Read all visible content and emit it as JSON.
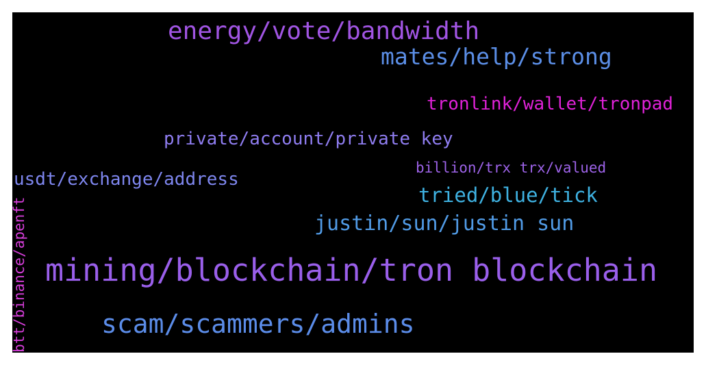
{
  "wordcloud": {
    "background": "#000000",
    "words": [
      {
        "text": "energy/vote/bandwidth",
        "color": "#a155e3"
      },
      {
        "text": "mates/help/strong",
        "color": "#5b8ee6"
      },
      {
        "text": "tronlink/wallet/tronpad",
        "color": "#e022d8"
      },
      {
        "text": "private/account/private key",
        "color": "#8f7df0"
      },
      {
        "text": "billion/trx trx/valued",
        "color": "#9d63e8"
      },
      {
        "text": "usdt/exchange/address",
        "color": "#7e86ee"
      },
      {
        "text": "tried/blue/tick",
        "color": "#3fb2e2"
      },
      {
        "text": "justin/sun/justin sun",
        "color": "#519be6"
      },
      {
        "text": "mining/blockchain/tron blockchain",
        "color": "#9a5fea"
      },
      {
        "text": "scam/scammers/admins",
        "color": "#5b8ce8"
      },
      {
        "text": "btt/binance/apenft",
        "color": "#d53ed9"
      }
    ]
  }
}
